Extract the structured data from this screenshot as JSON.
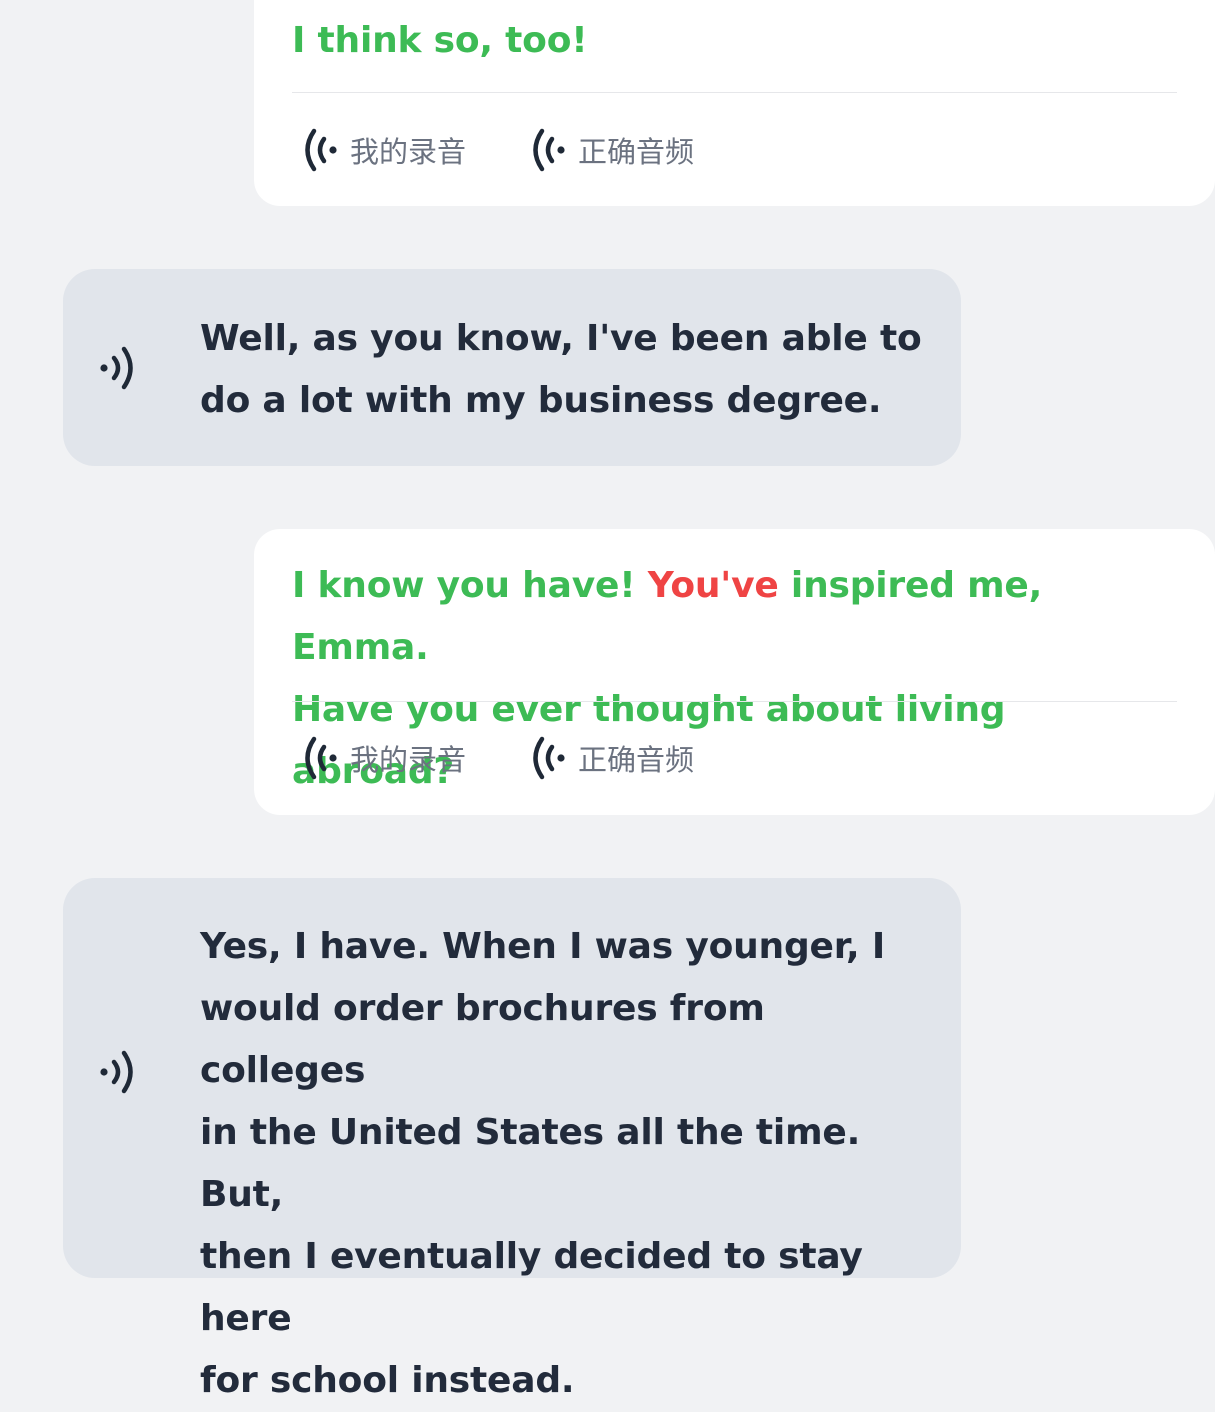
{
  "conversation": {
    "user_1": {
      "text": "I think so, too!",
      "my_recording_label": "我的录音",
      "correct_audio_label": "正确音频"
    },
    "bot_1": {
      "text_line1": "Well, as you know, I've been able to",
      "text_line2": "do a lot with my business degree."
    },
    "user_2": {
      "text_part1": "I know you have! ",
      "text_wrong": "You've",
      "text_part2": " inspired me, Emma.",
      "text_line2": "Have you ever thought about living abroad?",
      "my_recording_label": "我的录音",
      "correct_audio_label": "正确音频"
    },
    "bot_2": {
      "lines": [
        "Yes, I have. When I was younger, I",
        "would order brochures from colleges",
        "in the United States all the time. But,",
        "then I eventually decided to stay here",
        "for school instead."
      ]
    }
  },
  "icons": {
    "recording": "wave-left-icon",
    "speaker": "sound-wave-icon"
  },
  "colors": {
    "correct_text": "#3dbb55",
    "wrong_text": "#ef4444",
    "bot_text": "#222b3b",
    "bot_bubble": "#e1e5eb",
    "user_card": "#ffffff",
    "background": "#f1f2f4",
    "icon": "#1f2937"
  }
}
